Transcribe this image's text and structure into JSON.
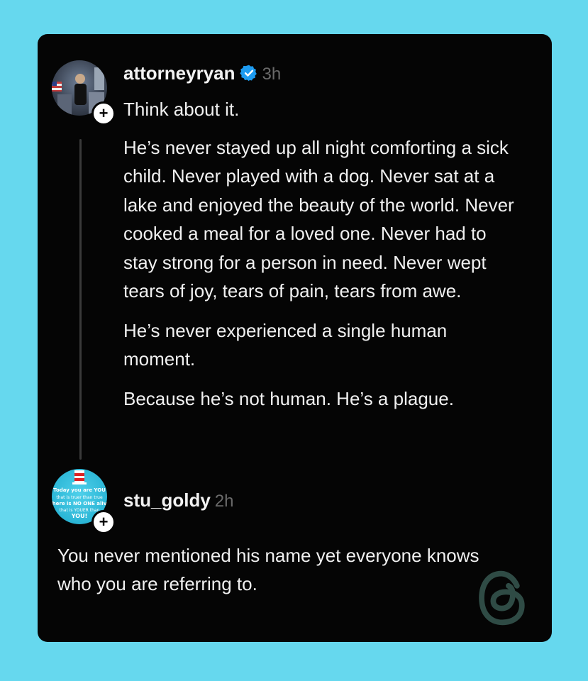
{
  "post": {
    "username": "attorneyryan",
    "time": "3h",
    "paragraphs": [
      "Think about it.",
      "He’s never stayed up all night comforting a sick child. Never played with a dog. Never sat at a lake and enjoyed the beauty of the world. Never cooked a meal for a loved one. Never had to stay strong for a person in need. Never wept tears of joy, tears of pain, tears from awe.",
      "He’s never experienced a single human moment.",
      "Because he’s not human. He’s a plague."
    ]
  },
  "reply": {
    "username": "stu_goldy",
    "time": "2h",
    "text": "You never mentioned his name yet everyone knows who you are referring to."
  },
  "colors": {
    "background": "#66d8ee",
    "card": "#050505",
    "verified": "#1d9bf0",
    "time": "#6a6a6a",
    "logo": "#2f4b45"
  }
}
